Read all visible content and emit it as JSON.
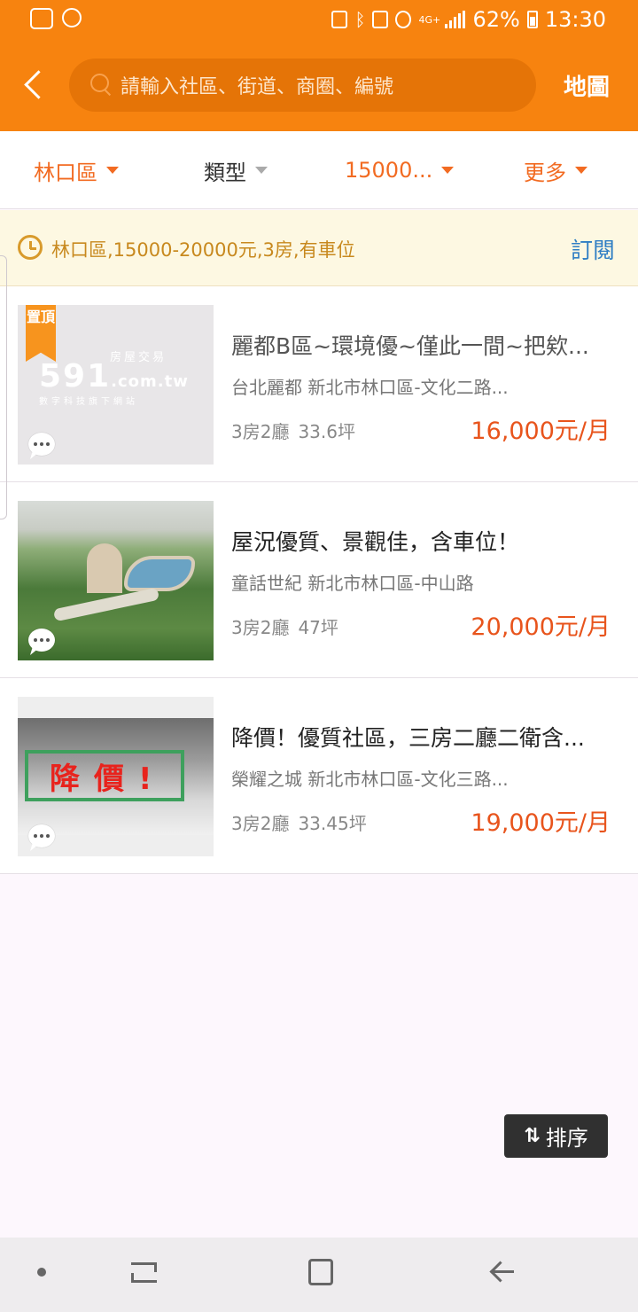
{
  "status_bar": {
    "battery": "62%",
    "time": "13:30",
    "network": "4G+",
    "icons": [
      "app-icon",
      "app-icon",
      "recycle-icon",
      "bluetooth-icon",
      "nfc-icon",
      "alarm-icon",
      "signal-icon",
      "battery-icon"
    ]
  },
  "header": {
    "search_placeholder": "請輸入社區、街道、商圈、編號",
    "map_label": "地圖",
    "colors": {
      "brand": "#f7830f",
      "search_bg": "#e57407"
    }
  },
  "filters": [
    {
      "label": "林口區",
      "active": true
    },
    {
      "label": "類型",
      "active": false
    },
    {
      "label": "15000...",
      "active": true
    },
    {
      "label": "更多",
      "active": true
    }
  ],
  "subscription": {
    "criteria": "林口區,15000-20000元,3房,有車位",
    "subscribe_label": "訂閱"
  },
  "listings": [
    {
      "title": "麗都B區~環境優~僅此一間~把欸...",
      "address": "台北麗都 新北市林口區-文化二路...",
      "rooms": "3房2廳",
      "area": "33.6坪",
      "price": "16,000元/月",
      "pinned": true,
      "pin_label": "置頂",
      "placeholder_brand": "591",
      "placeholder_domain": ".com.tw",
      "placeholder_tagline": "房屋交易",
      "placeholder_sub": "數字科技旗下網站"
    },
    {
      "title": "屋況優質、景觀佳，含車位！",
      "address": "童話世紀 新北市林口區-中山路",
      "rooms": "3房2廳",
      "area": "47坪",
      "price": "20,000元/月",
      "pinned": false
    },
    {
      "title": "降價！優質社區，三房二廳二衛含...",
      "address": "榮耀之城 新北市林口區-文化三路...",
      "rooms": "3房2廳",
      "area": "33.45坪",
      "price": "19,000元/月",
      "pinned": false,
      "image_text": "降價!"
    }
  ],
  "sort": {
    "label": "排序"
  },
  "accent_colors": {
    "price": "#e8541c",
    "subscribe": "#2f7ec4",
    "criteria": "#c8891e"
  }
}
